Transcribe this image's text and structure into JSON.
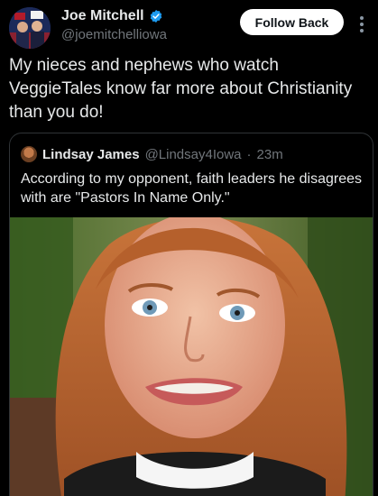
{
  "post": {
    "display_name": "Joe Mitchell",
    "handle": "@joemitchelliowa",
    "follow_label": "Follow Back",
    "text": "My nieces and nephews who watch VeggieTales know far more about Christianity than you do!"
  },
  "quote": {
    "display_name": "Lindsay James",
    "handle": "@Lindsay4Iowa",
    "separator": "·",
    "time": "23m",
    "text": "According to my opponent, faith leaders he disagrees with are \"Pastors In Name Only.\""
  },
  "icons": {
    "verified": "verified-badge-icon",
    "more": "more-options-icon"
  },
  "colors": {
    "background": "#000000",
    "text_primary": "#e7e9ea",
    "text_secondary": "#71767b",
    "verified": "#1d9bf0",
    "follow_button_bg": "#ffffff",
    "border": "#2f3336"
  }
}
